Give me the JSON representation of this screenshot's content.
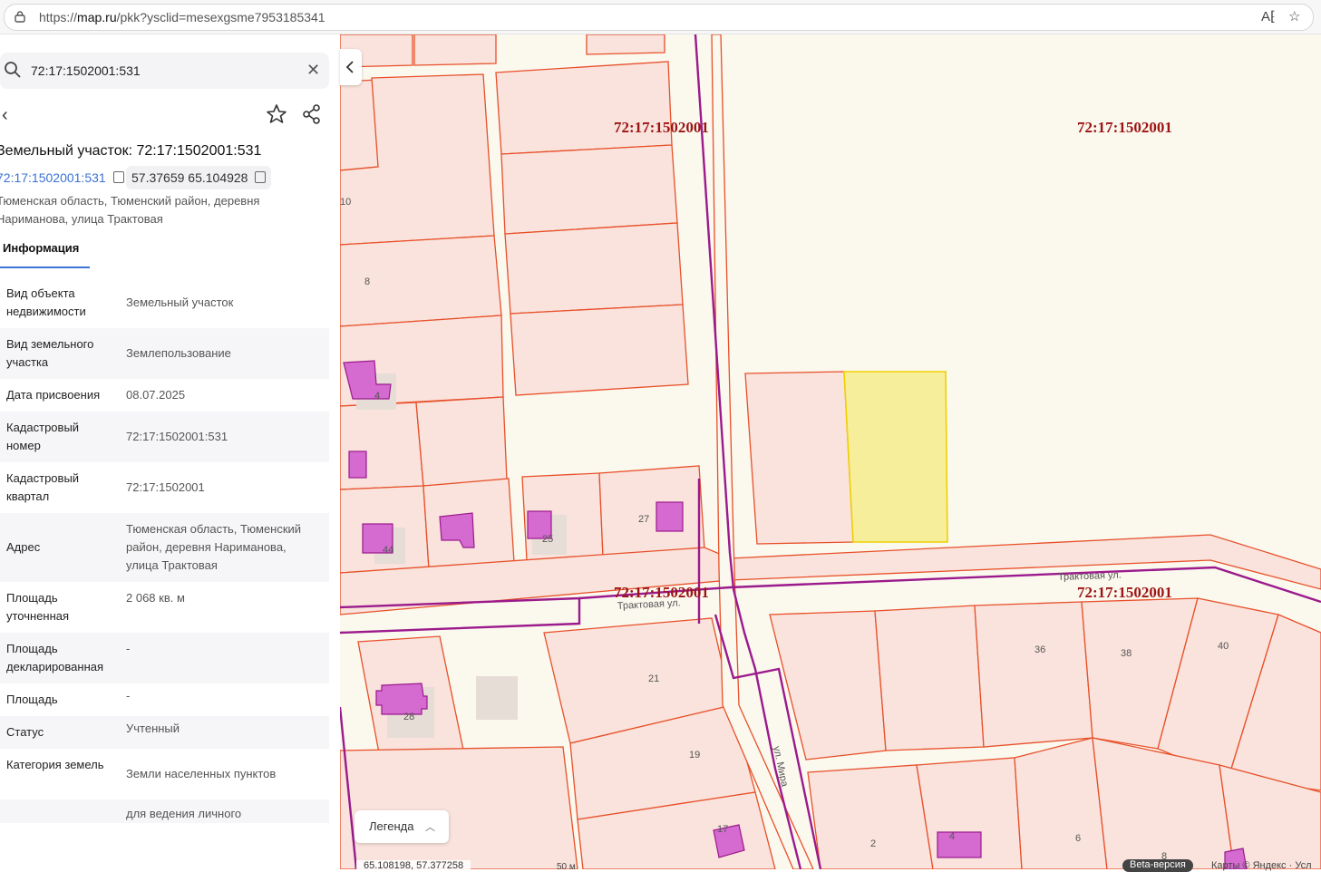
{
  "browser": {
    "url_prefix": "https://",
    "url_host": "map.ru",
    "url_path": "/pkk?ysclid=mesexgsme7953185341"
  },
  "search": {
    "query": "72:17:1502001:531"
  },
  "panel": {
    "title": "Земельный участок: 72:17:1502001:531",
    "cad_link": "72:17:1502001:531",
    "coords": "57.37659 65.104928",
    "address": "Тюменская область, Тюменский район, деревня Нариманова, улица Трактовая",
    "tab": "Информация",
    "rows": [
      {
        "k": "Вид объекта недвижимости",
        "v": "Земельный участок"
      },
      {
        "k": "Вид земельного участка",
        "v": "Землепользование"
      },
      {
        "k": "Дата присвоения",
        "v": "08.07.2025"
      },
      {
        "k": "Кадастровый номер",
        "v": "72:17:1502001:531"
      },
      {
        "k": "Кадастровый квартал",
        "v": "72:17:1502001"
      },
      {
        "k": "Адрес",
        "v": "Тюменская область, Тюменский район, деревня Нариманова, улица Трактовая"
      },
      {
        "k": "Площадь уточненная",
        "v": "2 068 кв. м"
      },
      {
        "k": "Площадь декларированная",
        "v": "-"
      },
      {
        "k": "Площадь",
        "v": "-"
      },
      {
        "k": "Статус",
        "v": "Учтенный"
      },
      {
        "k": "Категория земель",
        "v": "Земли населенных пунктов"
      },
      {
        "k": "",
        "v": "для ведения личного"
      }
    ]
  },
  "map": {
    "quarter_label": "72:17:1502001",
    "street_traktovaya": "Трактовая ул.",
    "street_mira": "ул. Мира",
    "plot_numbers": [
      "10",
      "8",
      "4",
      "44",
      "25",
      "27",
      "21",
      "19",
      "17",
      "28",
      "36",
      "38",
      "40",
      "2",
      "4",
      "6",
      "8"
    ],
    "legend": "Легенда",
    "cursor_coords": "65.108198, 57.377258",
    "scale": "50 м",
    "beta": "Beta-версия",
    "attribution": "Карты © Яндекс · Усл"
  },
  "colors": {
    "parcel_stroke": "#e8502a",
    "parcel_fill": "#f9e3dc",
    "quarter_border": "#9b1a8c",
    "selected": "#f7ee9c",
    "building": "#d56ad0"
  }
}
